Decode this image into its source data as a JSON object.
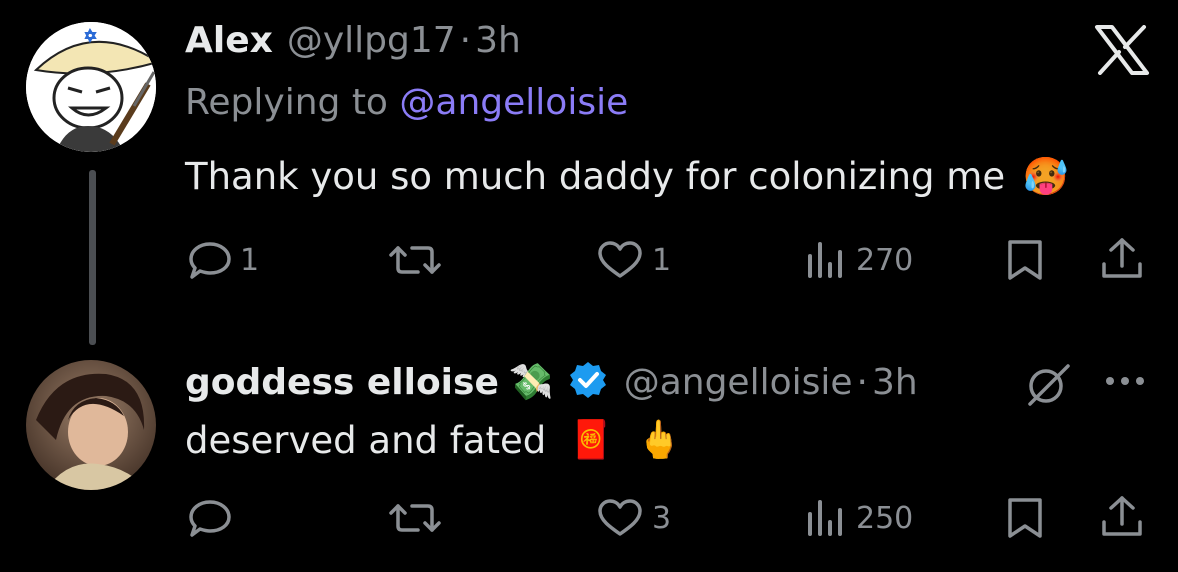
{
  "app": {
    "logo_icon": "x-logo-icon"
  },
  "tweets": [
    {
      "author_name": "Alex",
      "handle": "@yllpg17",
      "time": "3h",
      "replying_prefix": "Replying to",
      "replying_to": "@angelloisie",
      "text": "Thank you so much daddy for colonizing me",
      "text_emoji": "🥵",
      "stats": {
        "replies": "1",
        "reposts": "",
        "likes": "1",
        "views": "270"
      }
    },
    {
      "author_name": "goddess elloise",
      "name_emoji": "💸",
      "verified": true,
      "handle": "@angelloisie",
      "time": "3h",
      "text": "deserved and fated",
      "text_emoji_1": "🧧",
      "text_emoji_2": "🖕",
      "stats": {
        "replies": "",
        "reposts": "",
        "likes": "3",
        "views": "250"
      }
    }
  ],
  "colors": {
    "background": "#000000",
    "text": "#e7e9ea",
    "muted": "#8b8f94",
    "mention": "#8b7cf6",
    "verified": "#1d9bf0"
  }
}
